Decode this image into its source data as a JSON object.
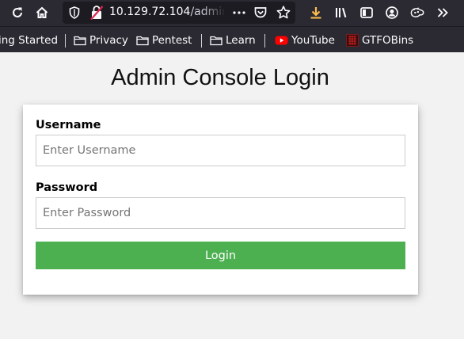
{
  "browser": {
    "url_host": "10.129.72.104",
    "url_path": "/admin",
    "icons": [
      "reload-icon",
      "home-icon",
      "shield-icon",
      "insecure-lock-icon",
      "more-icon",
      "pocket-icon",
      "star-icon",
      "download-icon",
      "library-icon",
      "sidebar-icon",
      "account-icon",
      "extension-icon",
      "overflow-icon"
    ]
  },
  "bookmarks": [
    {
      "label": "ing Started",
      "icon": "none"
    },
    {
      "label": "Privacy",
      "icon": "folder-icon"
    },
    {
      "label": "Pentest",
      "icon": "folder-icon"
    },
    {
      "label": "Learn",
      "icon": "folder-icon"
    },
    {
      "label": "YouTube",
      "icon": "youtube-icon"
    },
    {
      "label": "GTFOBins",
      "icon": "gtfobins-icon"
    }
  ],
  "page": {
    "title": "Admin Console Login",
    "username_label": "Username",
    "username_placeholder": "Enter Username",
    "username_value": "",
    "password_label": "Password",
    "password_placeholder": "Enter Password",
    "password_value": "",
    "login_label": "Login"
  },
  "colors": {
    "toolbar_bg": "#2b2a33",
    "url_bg": "#1c1b22",
    "page_bg": "#f2f2f2",
    "button_green": "#4caf50",
    "download_accent": "#ffbd4f",
    "youtube_red": "#ff0000"
  }
}
